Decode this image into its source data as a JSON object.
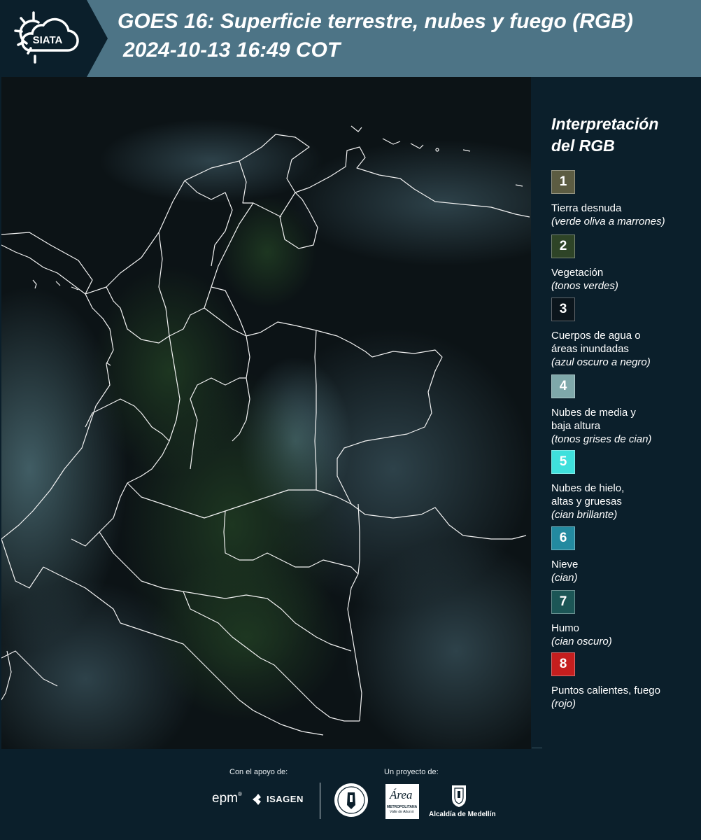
{
  "header": {
    "logo_text": "SIATA",
    "title_line1": "GOES 16: Superficie terrestre, nubes y fuego (RGB)",
    "title_line2": "2024-10-13 16:49 COT"
  },
  "map": {
    "icon": "satellite-map-image"
  },
  "legend": {
    "title_line1": "Interpretación",
    "title_line2": "del RGB",
    "items": [
      {
        "number": "1",
        "color": "#5c5c42",
        "line1": "Tierra desnuda",
        "line2": "",
        "note": "(verde oliva a marrones)"
      },
      {
        "number": "2",
        "color": "#2e4427",
        "line1": "Vegetación",
        "line2": "",
        "note": "(tonos verdes)"
      },
      {
        "number": "3",
        "color": "#0b151c",
        "line1": "Cuerpos de agua o",
        "line2": "áreas inundadas",
        "note": "(azul oscuro a negro)"
      },
      {
        "number": "4",
        "color": "#7fa8aa",
        "line1": "Nubes de media y",
        "line2": "baja altura",
        "note": "(tonos grises de cian)"
      },
      {
        "number": "5",
        "color": "#3fe0dc",
        "line1": "Nubes de hielo,",
        "line2": "altas y gruesas",
        "note": "(cian brillante)"
      },
      {
        "number": "6",
        "color": "#238aa0",
        "line1": "Nieve",
        "line2": "",
        "note": "(cian)"
      },
      {
        "number": "7",
        "color": "#1c5656",
        "line1": "Humo",
        "line2": "",
        "note": "(cian oscuro)"
      },
      {
        "number": "8",
        "color": "#c51e1e",
        "line1": "Puntos calientes, fuego",
        "line2": "",
        "note": "(rojo)"
      }
    ]
  },
  "footer": {
    "support_label": "Con el apoyo de:",
    "project_label": "Un proyecto de:",
    "epm_text": "epm",
    "isagen_text": "ISAGEN",
    "area_text": "Área",
    "area_sub1": "METROPOLITANA",
    "area_sub2": "Valle de Aburrá",
    "medellin_text": "Alcaldía de Medellín"
  }
}
